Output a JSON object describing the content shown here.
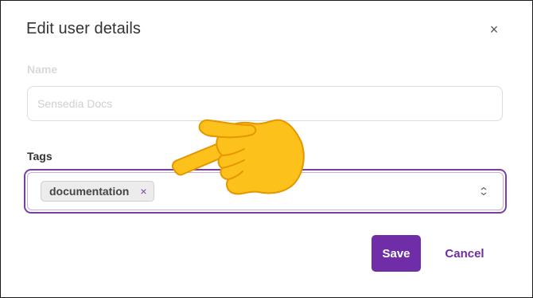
{
  "dialog": {
    "title": "Edit user details",
    "close_glyph": "×"
  },
  "name": {
    "label": "Name",
    "value": "Sensedia Docs"
  },
  "tags": {
    "label": "Tags",
    "chips": [
      {
        "label": "documentation",
        "remove_glyph": "×"
      }
    ],
    "stepper_glyph": "⌃⌄"
  },
  "actions": {
    "save_label": "Save",
    "cancel_label": "Cancel"
  },
  "colors": {
    "accent": "#6f2da8",
    "pointer_fill": "#fcc21b",
    "pointer_outline": "#e59600"
  },
  "icons": {
    "close": "close-icon",
    "chip_remove": "remove-tag-icon",
    "stepper": "chevron-up-down-icon",
    "pointer": "pointing-hand-icon"
  }
}
